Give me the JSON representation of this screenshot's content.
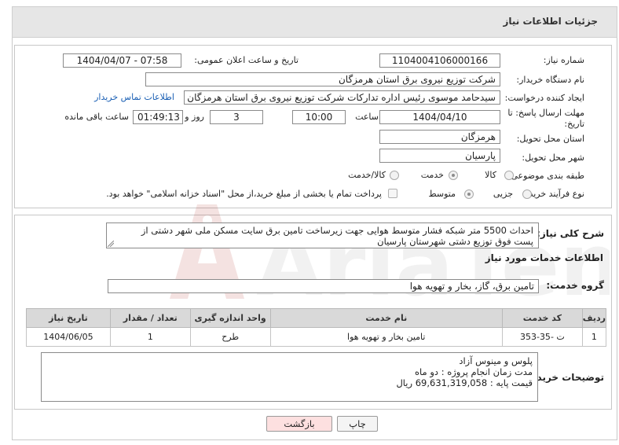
{
  "header": {
    "title": "جزئیات اطلاعات نیاز"
  },
  "need_number": {
    "label": "شماره نیاز:",
    "value": "1104004106000166"
  },
  "announce": {
    "label": "تاریخ و ساعت اعلان عمومی:",
    "value": "1404/04/07 - 07:58"
  },
  "buyer_org": {
    "label": "نام دستگاه خریدار:",
    "value": "شرکت توزیع نیروی برق استان هرمزگان"
  },
  "requester": {
    "label": "ایجاد کننده درخواست:",
    "value": "سیدحامد موسوی رئیس اداره تدارکات شرکت توزیع نیروی برق استان هرمزگان",
    "contact_link": "اطلاعات تماس خریدار"
  },
  "deadline": {
    "label_line1": "مهلت ارسال پاسخ: تا",
    "label_line2": "تاریخ:",
    "date": "1404/04/10",
    "time_label": "ساعت",
    "time": "10:00",
    "days_value": "3",
    "days_label": "روز و",
    "remaining": "01:49:13",
    "remaining_label": "ساعت باقی مانده"
  },
  "province": {
    "label": "استان محل تحویل:",
    "value": "هرمزگان"
  },
  "city": {
    "label": "شهر محل تحویل:",
    "value": "پارسیان"
  },
  "category": {
    "label": "طبقه بندی موضوعی:",
    "options": [
      "کالا",
      "خدمت",
      "کالا/خدمت"
    ],
    "selected": "خدمت"
  },
  "process": {
    "label": "نوع فرآیند خرید :",
    "options": [
      "جزیی",
      "متوسط"
    ],
    "selected": "متوسط",
    "payment_text": "پرداخت تمام یا بخشی از مبلغ خرید،از محل \"اسناد خزانه اسلامی\" خواهد بود."
  },
  "description": {
    "label": "شرح کلی نیاز:",
    "line1": "احداث 5500 متر شبکه فشار متوسط هوایی جهت زیرساخت تامین برق سایت مسکن ملی شهر دشتی از",
    "line2": "پست فوق توزیع دشتی شهرستان پارسیان"
  },
  "services_title": "اطلاعات خدمات مورد نیاز",
  "service_group": {
    "label": "گروه خدمت:",
    "value": "تامین برق، گاز، بخار و تهویه هوا"
  },
  "table": {
    "headers": [
      "ردیف",
      "کد خدمت",
      "نام خدمت",
      "واحد اندازه گیری",
      "تعداد / مقدار",
      "تاریخ نیاز"
    ],
    "rows": [
      [
        "1",
        "ت -35-353",
        "تامین بخار و تهویه هوا",
        "طرح",
        "1",
        "1404/06/05"
      ]
    ]
  },
  "buyer_notes": {
    "label": "توضیحات خریدار:",
    "line1": "پلوس و مینوس آزاد",
    "line2": "مدت زمان انجام پروژه : دو  ماه",
    "line3": "قیمت پایه : 69,631,319,058   ریال"
  },
  "buttons": {
    "print": "چاپ",
    "back": "بازگشت"
  },
  "watermark": {
    "text": "AriaTender.net"
  },
  "colors": {
    "link": "#1a5fb4",
    "header_bg": "#e6e6e6",
    "table_header": "#d9d9d9",
    "back_button": "#fde0e0"
  }
}
